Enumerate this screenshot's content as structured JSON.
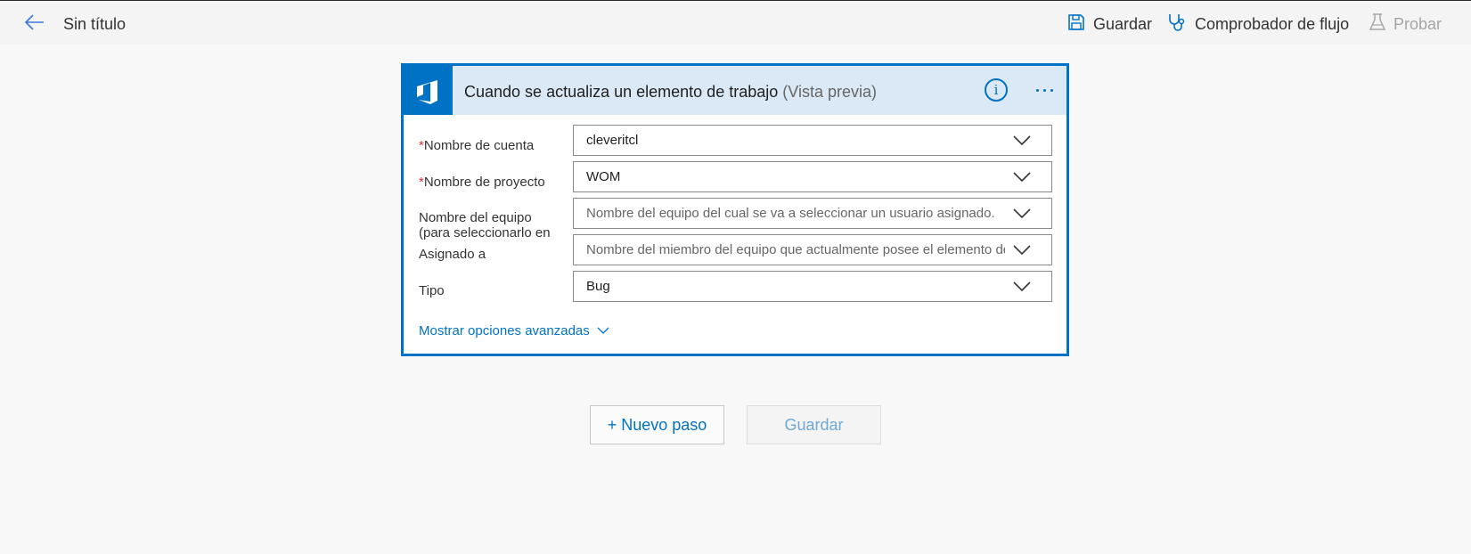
{
  "header": {
    "title": "Sin título",
    "commands": {
      "save_label": "Guardar",
      "checker_label": "Comprobador de flujo",
      "test_label": "Probar"
    }
  },
  "trigger": {
    "title": "Cuando se actualiza un elemento de trabajo",
    "preview_tag": "(Vista previa)",
    "info_glyph": "i",
    "fields": {
      "account": {
        "required_mark": "*",
        "label": "Nombre de cuenta",
        "value": "cleveritcl"
      },
      "project": {
        "required_mark": "*",
        "label": "Nombre de proyecto",
        "value": "WOM"
      },
      "team": {
        "label_line1": "Nombre del equipo",
        "label_line2": "(para seleccionarlo en",
        "placeholder": "Nombre del equipo del cual se va a seleccionar un usuario asignado."
      },
      "assigned_to": {
        "label": "Asignado a",
        "placeholder": "Nombre del miembro del equipo que actualmente posee el elemento de trabajo."
      },
      "type": {
        "label": "Tipo",
        "value": "Bug"
      }
    },
    "advanced_label": "Mostrar opciones avanzadas"
  },
  "actions": {
    "new_step_label": "+ Nuevo paso",
    "save_label": "Guardar"
  },
  "colors": {
    "accent": "#0072c6",
    "header_bg": "#f4f4f4",
    "card_header_bg": "#dbe9f7",
    "required": "#d13438",
    "disabled_text": "#a6a6a6"
  }
}
